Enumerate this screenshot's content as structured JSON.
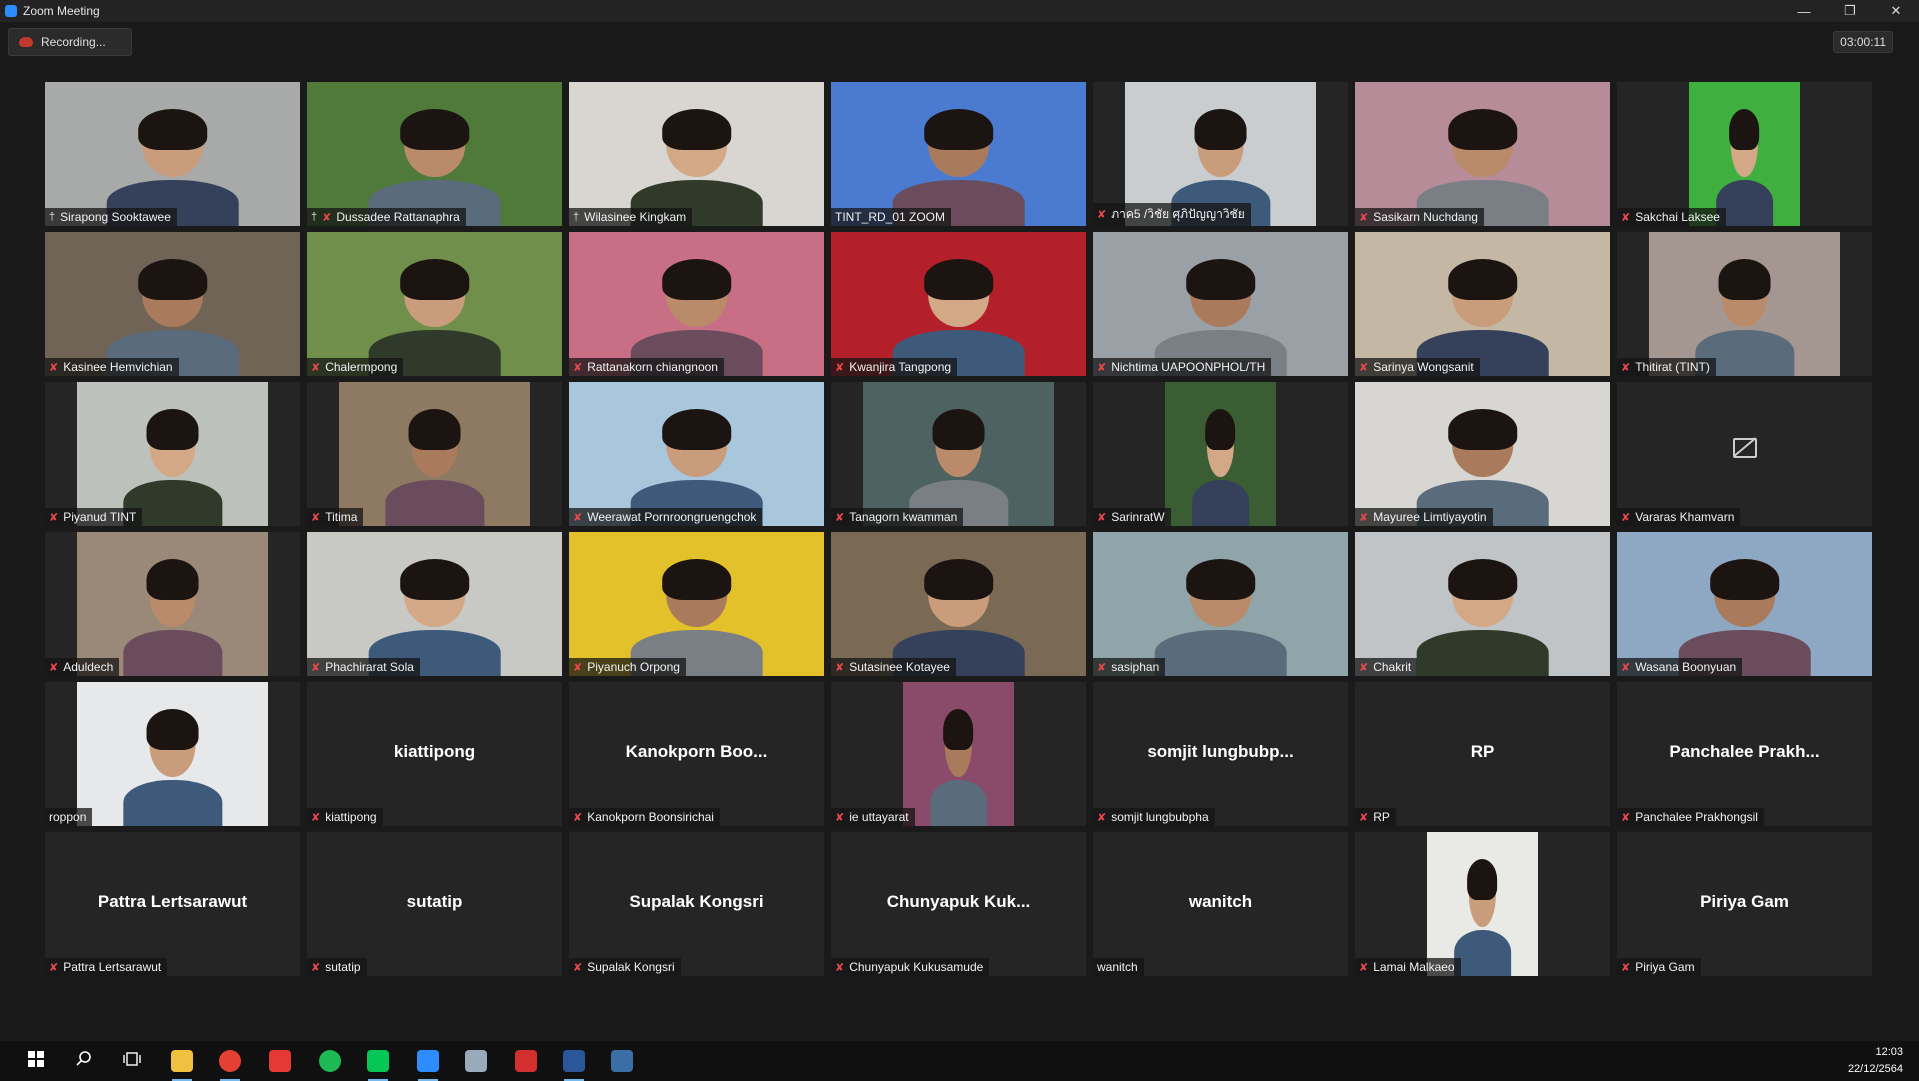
{
  "window": {
    "title": "Zoom Meeting"
  },
  "recording": {
    "label": "Recording..."
  },
  "timer": "03:00:11",
  "tiles": [
    {
      "name": "Sirapong Sooktawee",
      "type": "video",
      "bg": "#a7aaa8",
      "pinned": true,
      "muted": false
    },
    {
      "name": "Dussadee Rattanaphra",
      "type": "video",
      "bg": "#4f7a3a",
      "pinned": true,
      "muted": true
    },
    {
      "name": "Wilasinee Kingkam",
      "type": "video",
      "bg": "#d9d6d2",
      "pinned": true,
      "muted": false
    },
    {
      "name": "TINT_RD_01 ZOOM",
      "type": "video",
      "bg": "#4a7bd0",
      "pinned": false,
      "muted": false,
      "highlight": true
    },
    {
      "name": "ภาค5 /วิชัย ศุภิปัญญาวิชัย",
      "type": "video",
      "bg": "#c9cdd0",
      "pinned": false,
      "muted": true,
      "frame": "narrow"
    },
    {
      "name": "Sasikarn Nuchdang",
      "type": "video",
      "bg": "#b68c98",
      "pinned": false,
      "muted": true
    },
    {
      "name": "Sakchai Laksee",
      "type": "video",
      "bg": "#3fb03f",
      "pinned": false,
      "muted": true,
      "frame": "square"
    },
    {
      "name": "Kasinee Hemvichian",
      "type": "video",
      "bg": "#6f6456",
      "pinned": false,
      "muted": true
    },
    {
      "name": "Chalermpong",
      "type": "video",
      "bg": "#6f8f4a",
      "pinned": false,
      "muted": true
    },
    {
      "name": "Rattanakorn chiangnoon",
      "type": "video",
      "bg": "#c86f86",
      "pinned": false,
      "muted": true
    },
    {
      "name": "Kwanjira Tangpong",
      "type": "video",
      "bg": "#b3202a",
      "pinned": false,
      "muted": true
    },
    {
      "name": "Nichtima UAPOONPHOL/TH",
      "type": "video",
      "bg": "#9aa1a6",
      "pinned": false,
      "muted": true
    },
    {
      "name": "Sarinya Wongsanit",
      "type": "video",
      "bg": "#c4b7a3",
      "pinned": false,
      "muted": true
    },
    {
      "name": "Thitirat (TINT)",
      "type": "video",
      "bg": "#a49690",
      "pinned": false,
      "muted": true,
      "frame": "narrow"
    },
    {
      "name": "Piyanud TINT",
      "type": "video",
      "bg": "#bcc1bb",
      "pinned": false,
      "muted": true,
      "frame": "narrow"
    },
    {
      "name": "Titima",
      "type": "video",
      "bg": "#8e7a62",
      "pinned": false,
      "muted": true,
      "frame": "narrow"
    },
    {
      "name": "Weerawat Pornroongruengchok",
      "type": "video",
      "bg": "#a9c7dc",
      "pinned": false,
      "muted": true
    },
    {
      "name": "Tanagorn kwamman",
      "type": "video",
      "bg": "#4e6262",
      "pinned": false,
      "muted": true,
      "frame": "narrow"
    },
    {
      "name": "SarinratW",
      "type": "video",
      "bg": "#3a5d33",
      "pinned": false,
      "muted": true,
      "frame": "square"
    },
    {
      "name": "Mayuree Limtiyayotin",
      "type": "video",
      "bg": "#d8d6d2",
      "pinned": false,
      "muted": true
    },
    {
      "name": "Vararas Khamvarn",
      "type": "off",
      "muted": true,
      "camoff": true
    },
    {
      "name": "Aduldech",
      "type": "video",
      "bg": "#9a8878",
      "pinned": false,
      "muted": true,
      "frame": "narrow"
    },
    {
      "name": "Phachirarat Sola",
      "type": "video",
      "bg": "#c8c8c4",
      "pinned": false,
      "muted": true
    },
    {
      "name": "Piyanuch Orpong",
      "type": "video",
      "bg": "#e2c12a",
      "pinned": false,
      "muted": true
    },
    {
      "name": "Sutasinee Kotayee",
      "type": "video",
      "bg": "#7a6a55",
      "pinned": false,
      "muted": true
    },
    {
      "name": "sasiphan",
      "type": "video",
      "bg": "#8fa5a9",
      "pinned": false,
      "muted": true
    },
    {
      "name": "Chakrit",
      "type": "video",
      "bg": "#c0c4c6",
      "pinned": false,
      "muted": true
    },
    {
      "name": "Wasana Boonyuan",
      "type": "video",
      "bg": "#8ea8c4",
      "pinned": false,
      "muted": true
    },
    {
      "name": "roppon",
      "type": "video",
      "bg": "#e6e8ea",
      "pinned": false,
      "muted": false,
      "frame": "narrow"
    },
    {
      "name": "kiattipong",
      "type": "off",
      "big": "kiattipong",
      "muted": true
    },
    {
      "name": "Kanokporn Boonsirichai",
      "type": "off",
      "big": "Kanokporn  Boo...",
      "muted": true
    },
    {
      "name": "ie uttayarat",
      "type": "video",
      "bg": "#8a4a6a",
      "pinned": false,
      "muted": true,
      "frame": "square"
    },
    {
      "name": "somjit lungbubpha",
      "type": "off",
      "big": "somjit  lungbubp...",
      "muted": true
    },
    {
      "name": "RP",
      "type": "off",
      "big": "RP",
      "muted": true
    },
    {
      "name": "Panchalee Prakhongsil",
      "type": "off",
      "big": "Panchalee  Prakh...",
      "muted": true
    },
    {
      "name": "Pattra Lertsarawut",
      "type": "off",
      "big": "Pattra Lertsarawut",
      "muted": true
    },
    {
      "name": "sutatip",
      "type": "off",
      "big": "sutatip",
      "muted": true
    },
    {
      "name": "Supalak Kongsri",
      "type": "off",
      "big": "Supalak Kongsri",
      "muted": true
    },
    {
      "name": "Chunyapuk Kukusamude",
      "type": "off",
      "big": "Chunyapuk  Kuk...",
      "muted": true
    },
    {
      "name": "wanitch",
      "type": "off",
      "big": "wanitch",
      "muted": false
    },
    {
      "name": "Lamai Malkaeo",
      "type": "video",
      "bg": "#e9eae6",
      "pinned": false,
      "muted": true,
      "frame": "square"
    },
    {
      "name": "Piriya Gam",
      "type": "off",
      "big": "Piriya Gam",
      "muted": true
    }
  ],
  "taskbar": {
    "apps": [
      {
        "name": "start",
        "icon": "windows-icon",
        "color": "#ffffff"
      },
      {
        "name": "search",
        "icon": "search-icon",
        "color": "#ffffff"
      },
      {
        "name": "task-view",
        "icon": "task-view-icon",
        "color": "#ffffff"
      },
      {
        "name": "file-explorer",
        "icon": "folder-icon",
        "color": "#f0c040",
        "active": true
      },
      {
        "name": "chrome",
        "icon": "chrome-icon",
        "color": "#e44134",
        "active": true
      },
      {
        "name": "wps",
        "icon": "wps-icon",
        "color": "#e53935"
      },
      {
        "name": "spotify",
        "icon": "spotify-icon",
        "color": "#1db954"
      },
      {
        "name": "line",
        "icon": "line-icon",
        "color": "#06c755",
        "active": true
      },
      {
        "name": "zoom",
        "icon": "zoom-icon",
        "color": "#2d8cff",
        "active": true
      },
      {
        "name": "paint",
        "icon": "paint-icon",
        "color": "#9ab"
      },
      {
        "name": "acrobat",
        "icon": "pdf-icon",
        "color": "#d32f2f"
      },
      {
        "name": "word",
        "icon": "word-icon",
        "color": "#2b579a",
        "active": true
      },
      {
        "name": "calculator",
        "icon": "calculator-icon",
        "color": "#3a6ea5"
      }
    ],
    "time": "12:03",
    "date": "22/12/2564"
  }
}
